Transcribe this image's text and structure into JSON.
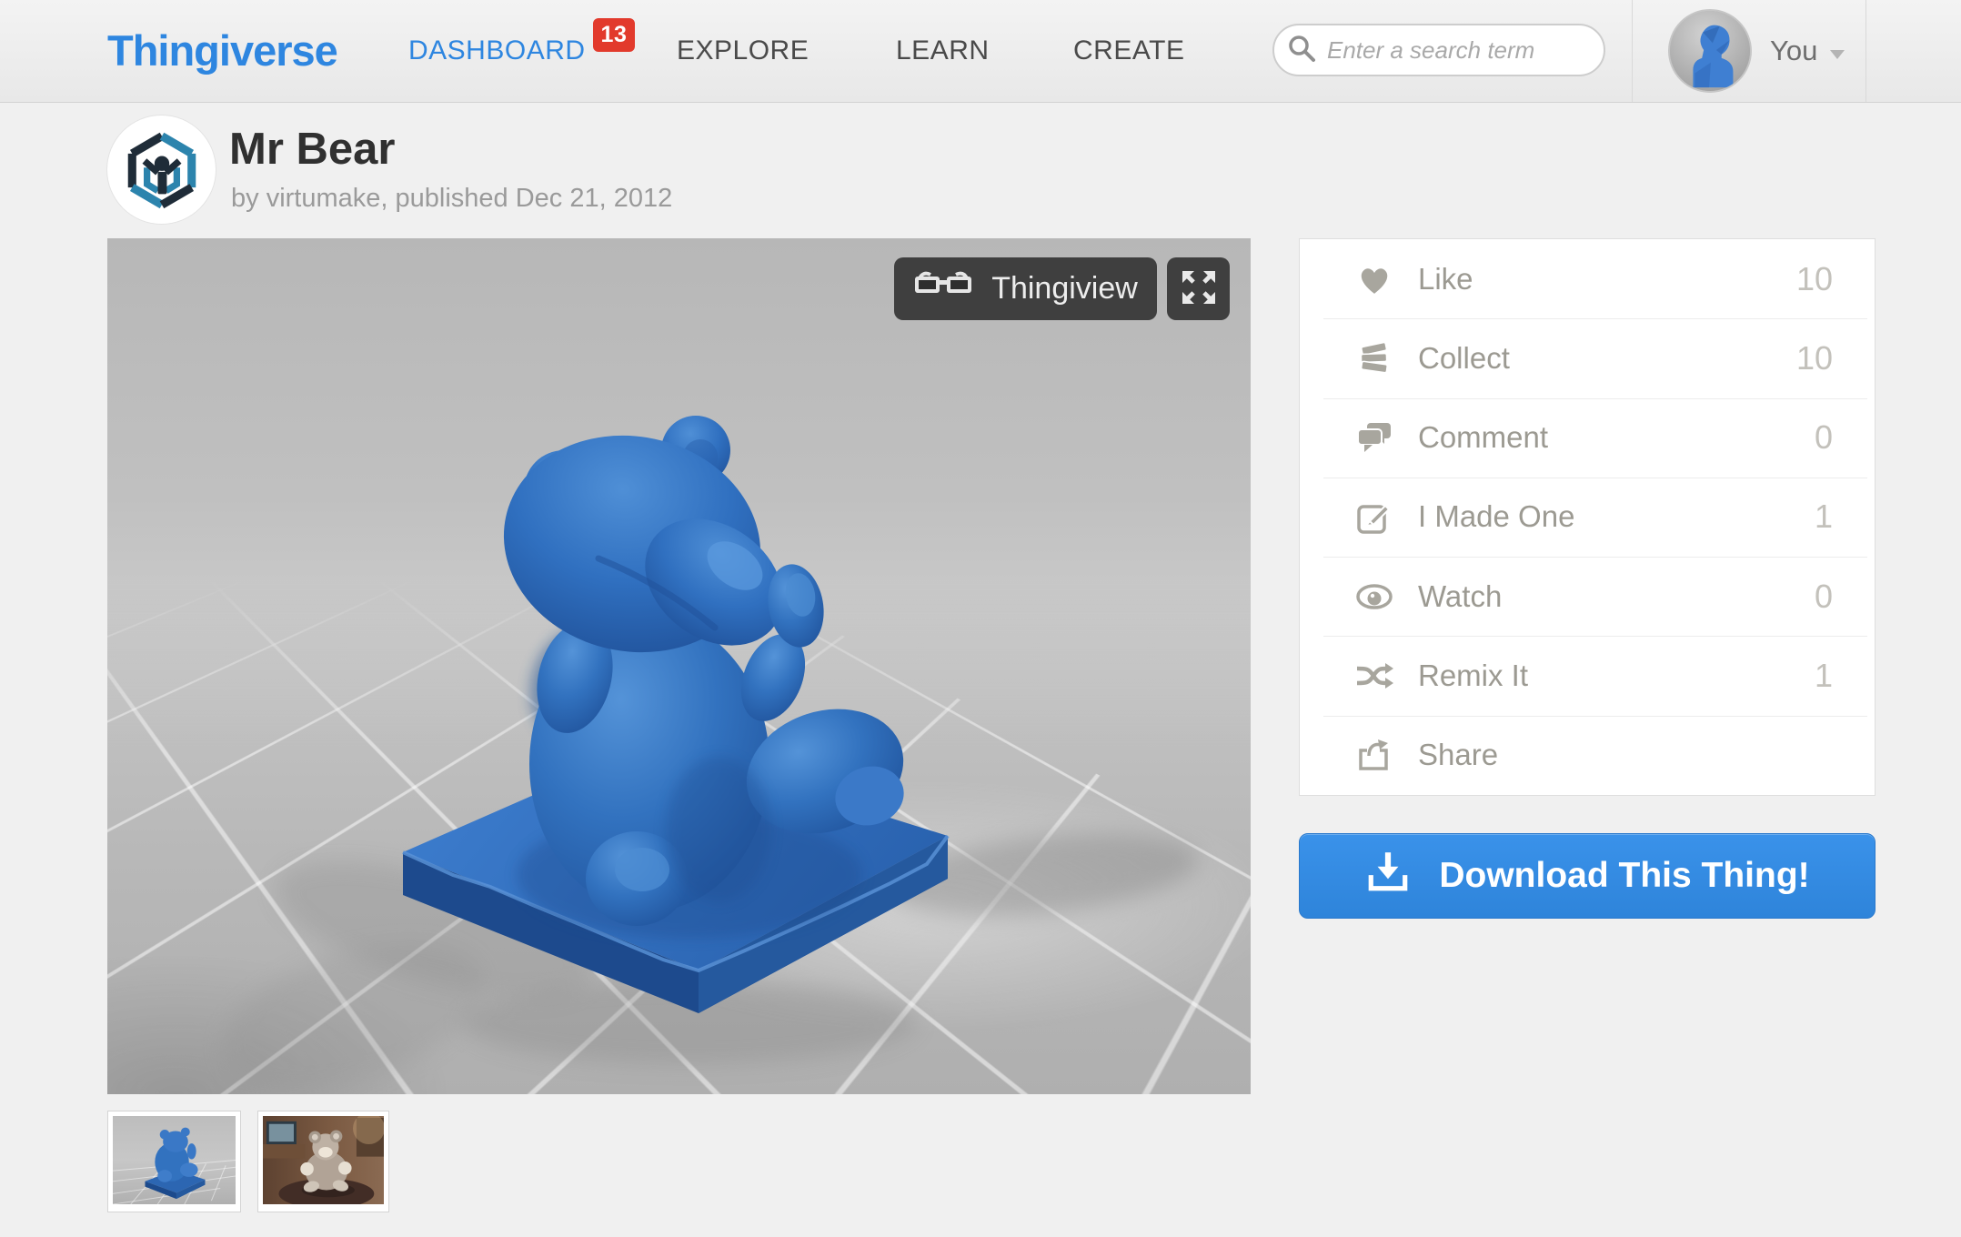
{
  "header": {
    "brand": "Thingiverse",
    "nav": [
      {
        "label": "DASHBOARD",
        "badge": "13"
      },
      {
        "label": "EXPLORE"
      },
      {
        "label": "LEARN"
      },
      {
        "label": "CREATE"
      }
    ],
    "search": {
      "placeholder": "Enter a search term",
      "icon": "search-icon"
    },
    "user": {
      "label": "You",
      "avatar_icon": "user-avatar-3d-bust",
      "menu_icon": "chevron-down-icon"
    }
  },
  "thing": {
    "title": "Mr Bear",
    "byline_prefix": "by ",
    "author": "virtumake",
    "byline_suffix": ", published Dec 21, 2012",
    "creator_logo_icon": "virtumake-cube-logo"
  },
  "viewer": {
    "thingiview_label": "Thingiview",
    "thingiview_icon": "3d-glasses-icon",
    "fullscreen_icon": "fullscreen-expand-icon",
    "model_description": "blue teddy bear model seated on rough square base, rear three-quarter view, gray grid floor"
  },
  "actions": [
    {
      "label": "Like",
      "count": "10",
      "icon": "heart-icon"
    },
    {
      "label": "Collect",
      "count": "10",
      "icon": "collect-stack-icon"
    },
    {
      "label": "Comment",
      "count": "0",
      "icon": "comment-bubbles-icon"
    },
    {
      "label": "I Made One",
      "count": "1",
      "icon": "pencil-box-icon"
    },
    {
      "label": "Watch",
      "count": "0",
      "icon": "eye-icon"
    },
    {
      "label": "Remix It",
      "count": "1",
      "icon": "shuffle-icon"
    },
    {
      "label": "Share",
      "count": "",
      "icon": "share-icon"
    }
  ],
  "download": {
    "label": "Download This Thing!",
    "icon": "download-tray-icon"
  },
  "thumbnails": [
    {
      "name": "render-thumbnail"
    },
    {
      "name": "photo-thumbnail"
    }
  ],
  "colors": {
    "brand_blue": "#2e86e0",
    "badge_red": "#e23a2c",
    "download_blue": "#3189e2",
    "model_blue": "#3272bf",
    "viewport_gray": "#bcbcbc"
  }
}
